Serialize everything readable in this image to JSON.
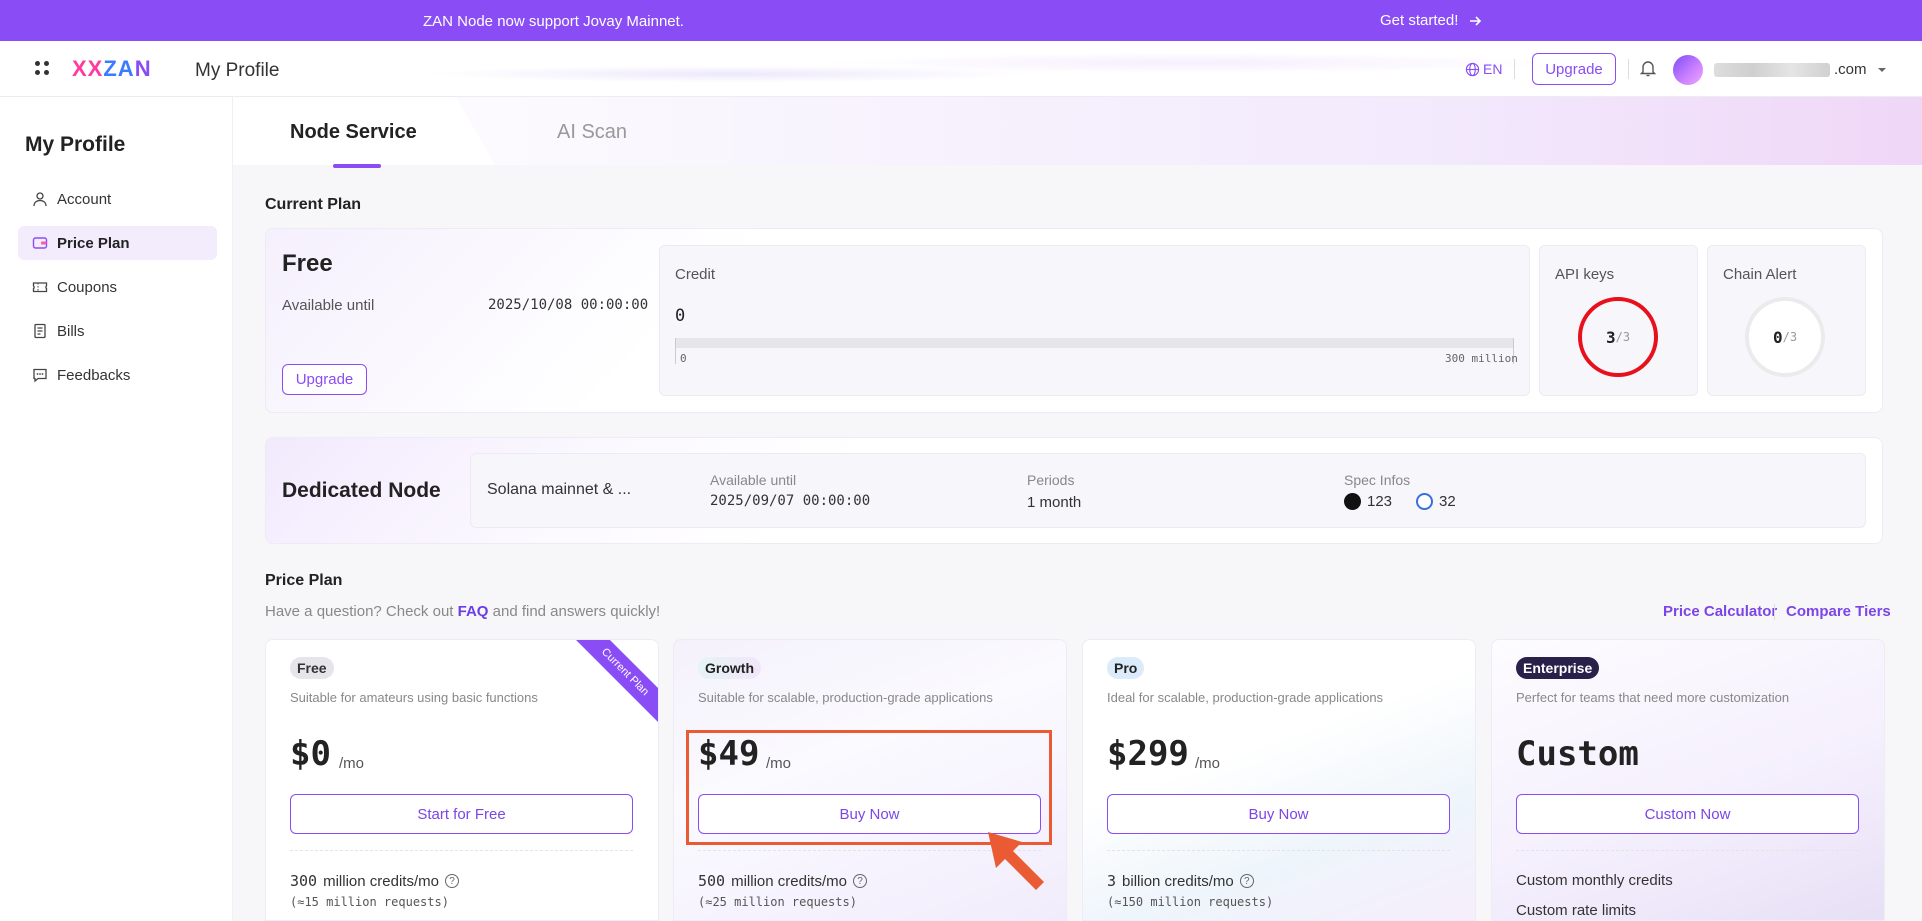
{
  "banner": {
    "message": "ZAN Node now support Jovay Mainnet.",
    "cta": "Get started!"
  },
  "header": {
    "logo_a": "XX",
    "logo_b": "ZA",
    "logo_c": "N",
    "title": "My Profile",
    "lang": "EN",
    "upgrade": "Upgrade",
    "email_suffix": ".com"
  },
  "sidebar": {
    "title": "My Profile",
    "items": [
      {
        "label": "Account",
        "icon": "user-icon"
      },
      {
        "label": "Price Plan",
        "icon": "wallet-icon"
      },
      {
        "label": "Coupons",
        "icon": "ticket-icon"
      },
      {
        "label": "Bills",
        "icon": "document-icon"
      },
      {
        "label": "Feedbacks",
        "icon": "message-icon"
      }
    ]
  },
  "tabs": [
    {
      "label": "Node Service"
    },
    {
      "label": "AI Scan"
    }
  ],
  "current_plan": {
    "section_title": "Current Plan",
    "name": "Free",
    "available_label": "Available until",
    "available_value": "2025/10/08 00:00:00",
    "upgrade": "Upgrade",
    "credit": {
      "label": "Credit",
      "value": "0",
      "min_label": "0",
      "max_label": "300 million",
      "used_fraction": 0
    },
    "api_keys": {
      "label": "API keys",
      "used": "3",
      "total": "/3"
    },
    "chain_alert": {
      "label": "Chain Alert",
      "used": "0",
      "total": "/3"
    }
  },
  "dedicated_node": {
    "title": "Dedicated Node",
    "name": "Solana mainnet & ...",
    "available_label": "Available until",
    "available_value": "2025/09/07 00:00:00",
    "periods_label": "Periods",
    "periods_value": "1 month",
    "spec_label": "Spec Infos",
    "spec_a": "123",
    "spec_b": "32"
  },
  "price_plan": {
    "section_title": "Price Plan",
    "sub_prefix": "Have a question? Check out",
    "faq": "FAQ",
    "sub_suffix": "and find answers quickly!",
    "price_calculator": "Price Calculator",
    "compare_tiers": "Compare Tiers",
    "tiers": [
      {
        "badge": "Free",
        "desc": "Suitable for amateurs using basic functions",
        "price": "$0",
        "per": "/mo",
        "cta": "Start for Free",
        "feature_num": "300",
        "feature_text": "million credits/mo",
        "feature_sub": "(≈15 million requests)",
        "ribbon": "Current Plan"
      },
      {
        "badge": "Growth",
        "desc": "Suitable for scalable, production-grade applications",
        "price": "$49",
        "per": "/mo",
        "cta": "Buy Now",
        "feature_num": "500",
        "feature_text": "million credits/mo",
        "feature_sub": "(≈25 million requests)"
      },
      {
        "badge": "Pro",
        "desc": "Ideal for scalable, production-grade applications",
        "price": "$299",
        "per": "/mo",
        "cta": "Buy Now",
        "feature_num": "3",
        "feature_text": "billion credits/mo",
        "feature_sub": "(≈150 million requests)"
      },
      {
        "badge": "Enterprise",
        "desc": "Perfect for teams that need more customization",
        "price": "Custom",
        "per": "",
        "cta": "Custom Now",
        "feature_num": "",
        "feature_text": "Custom monthly credits",
        "feature_sub": "Custom rate limits"
      }
    ]
  },
  "colors": {
    "accent": "#8a4cf5",
    "highlight": "#ea5a33",
    "alert_ring": "#e8101a"
  }
}
